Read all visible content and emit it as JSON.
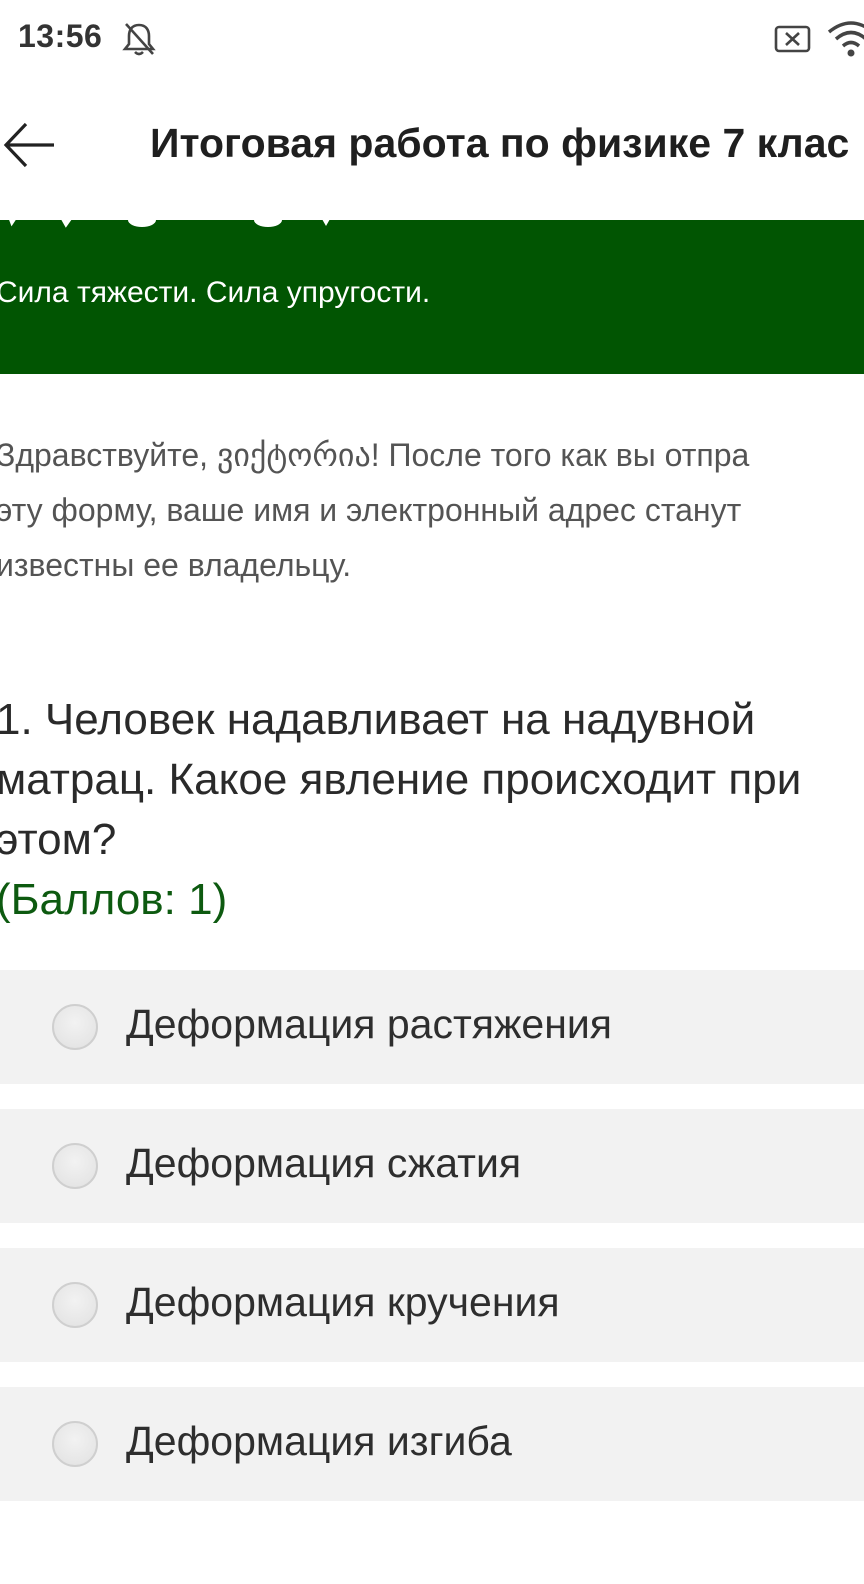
{
  "status_bar": {
    "time": "13:56",
    "icons": [
      "bell-off-icon",
      "x-box-icon",
      "wifi-icon"
    ]
  },
  "app_bar": {
    "back_icon": "arrow-left-icon",
    "title": "Итоговая работа по физике 7 клас"
  },
  "banner": {
    "subtitle": "Сила тяжести. Сила упругости.",
    "color": "#015502"
  },
  "notice": {
    "lines": [
      "Здравствуйте, ვიქტორია! После того как вы отпра",
      "эту форму, ваше имя и электронный адрес станут",
      "известны ее владельцу."
    ]
  },
  "question": {
    "lines": [
      "1. Человек надавливает на надувной",
      "матрац. Какое явление происходит при",
      "этом?"
    ],
    "points": "(Баллов: 1)",
    "points_color": "#0d5a10"
  },
  "options": [
    {
      "label": "Деформация растяжения",
      "selected": false
    },
    {
      "label": "Деформация сжатия",
      "selected": false
    },
    {
      "label": "Деформация кручения",
      "selected": false
    },
    {
      "label": "Деформация изгиба",
      "selected": false
    }
  ]
}
